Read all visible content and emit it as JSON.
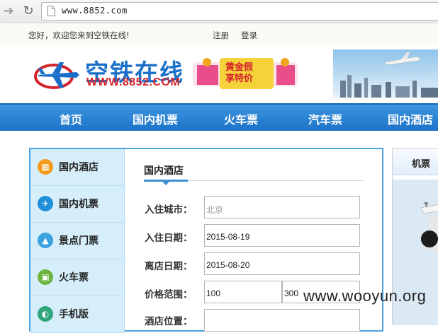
{
  "browser": {
    "url": "www.8852.com"
  },
  "topbar": {
    "welcome": "您好，欢迎您来到空铁在线!",
    "register": "注册",
    "login": "登录"
  },
  "header": {
    "logo_text": "空铁在线",
    "logo_url": "WWW.8852.COM",
    "promo_line1": "黄金假",
    "promo_line2": "享特价"
  },
  "main_nav": {
    "items": [
      {
        "label": "首页"
      },
      {
        "label": "国内机票"
      },
      {
        "label": "火车票"
      },
      {
        "label": "汽车票"
      },
      {
        "label": "国内酒店"
      }
    ]
  },
  "sidebar": {
    "items": [
      {
        "label": "国内酒店",
        "icon": "hotel-icon",
        "color": "#f29a1b"
      },
      {
        "label": "国内机票",
        "icon": "plane-icon",
        "color": "#1f8fd8"
      },
      {
        "label": "景点门票",
        "icon": "scenery-icon",
        "color": "#3aa3e0"
      },
      {
        "label": "火车票",
        "icon": "train-icon",
        "color": "#6db33f"
      },
      {
        "label": "手机版",
        "icon": "phone-icon",
        "color": "#2ea67c"
      }
    ]
  },
  "hotel_form": {
    "tab_label": "国内酒店",
    "city_label": "入住城市：",
    "city_placeholder": "北京",
    "checkin_label": "入住日期：",
    "checkin_value": "2015-08-19",
    "checkout_label": "离店日期：",
    "checkout_value": "2015-08-20",
    "price_label": "价格范围：",
    "price_min": "100",
    "price_max": "300",
    "location_label": "酒店位置："
  },
  "right_panel": {
    "title": "机票"
  },
  "watermark": "www.wooyun.org",
  "colors": {
    "nav_blue": "#1c73c8",
    "box_border": "#4ba3e2",
    "sidebar_bg": "#d6eef9",
    "logo_blue": "#1a6fc9",
    "logo_red": "#d4252c"
  }
}
